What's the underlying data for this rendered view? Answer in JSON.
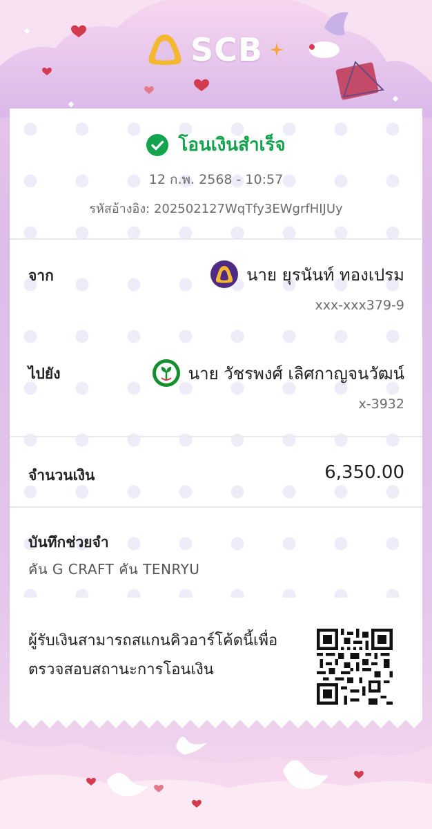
{
  "brand": {
    "name": "SCB"
  },
  "status": {
    "title": "โอนเงินสำเร็จ",
    "icon": "check-circle-icon",
    "color": "#14a44d"
  },
  "datetime": "12 ก.พ. 2568 - 10:57",
  "reference": "รหัสอ้างอิง: 202502127WqTfy3EWgrfHIJUy",
  "from": {
    "label": "จาก",
    "name": "นาย ยุรนันท์ ทองเปรม",
    "account": "xxx-xxx379-9",
    "bank_icon": "scb-bank-icon",
    "bank_color": "#4e2a84"
  },
  "to": {
    "label": "ไปยัง",
    "name": "นาย วัชรพงศ์ เลิศกาญจนวัฒน์",
    "account": "x-3932",
    "bank_icon": "kbank-bank-icon",
    "bank_color": "#138f2d"
  },
  "amount": {
    "label": "จำนวนเงิน",
    "value": "6,350.00"
  },
  "memo": {
    "label": "บันทึกช่วยจำ",
    "value": "คัน G CRAFT คัน TENRYU"
  },
  "qr": {
    "text": "ผู้รับเงินสามารถสแกนคิวอาร์โค้ดนี้เพื่อตรวจสอบสถานะการโอนเงิน",
    "icon": "qr-code-icon"
  }
}
